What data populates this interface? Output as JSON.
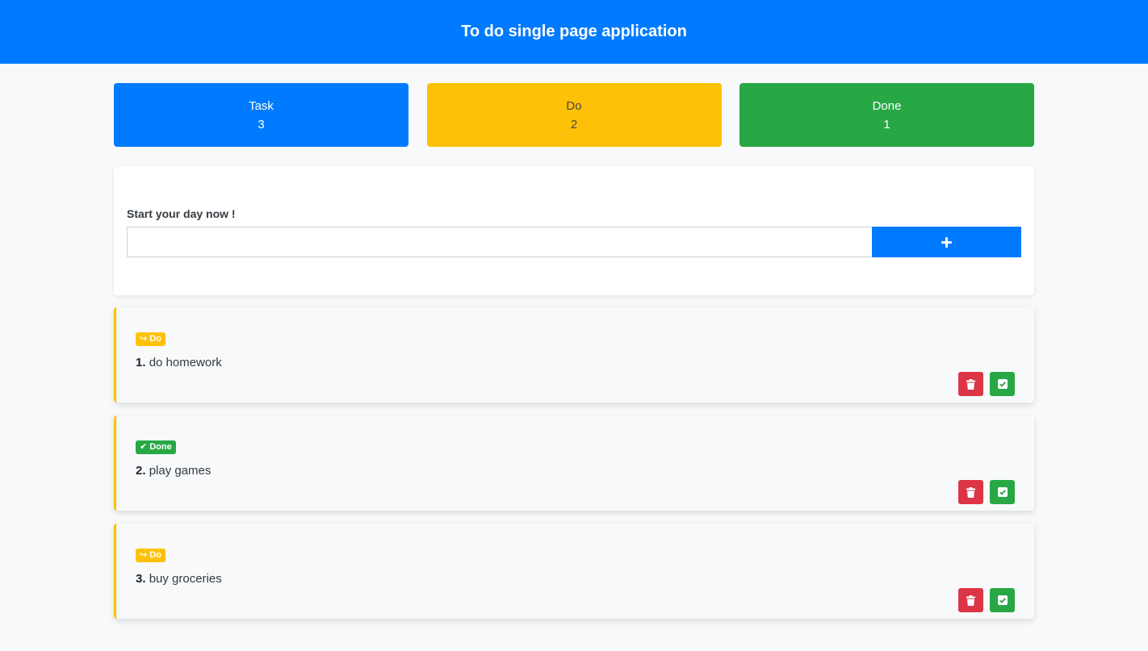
{
  "header": {
    "title": "To do single page application"
  },
  "stats": [
    {
      "label": "Task",
      "count": "3"
    },
    {
      "label": "Do",
      "count": "2"
    },
    {
      "label": "Done",
      "count": "1"
    }
  ],
  "form": {
    "label": "Start your day now !",
    "input_value": "",
    "add_icon": "plus-icon"
  },
  "tasks": [
    {
      "status": "Do",
      "status_icon": "sign-in-icon",
      "number": "1.",
      "text": "do homework"
    },
    {
      "status": "Done",
      "status_icon": "check-icon",
      "number": "2.",
      "text": "play games"
    },
    {
      "status": "Do",
      "status_icon": "sign-in-icon",
      "number": "3.",
      "text": "buy groceries"
    }
  ],
  "colors": {
    "primary": "#007bff",
    "warning": "#ffc107",
    "success": "#28a745",
    "danger": "#dc3545"
  }
}
